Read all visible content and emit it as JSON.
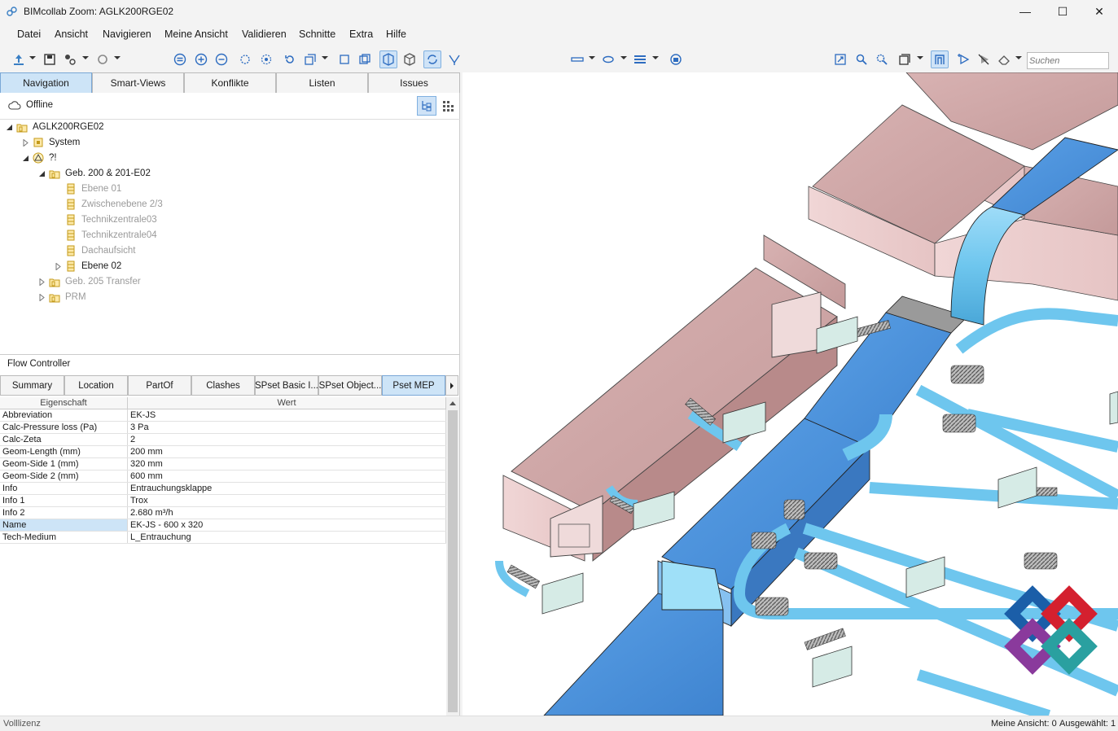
{
  "window": {
    "title": "BIMcollab Zoom: AGLK200RGE02",
    "minimize": "—",
    "maximize": "☐",
    "close": "✕"
  },
  "menu": [
    "Datei",
    "Ansicht",
    "Navigieren",
    "Meine Ansicht",
    "Validieren",
    "Schnitte",
    "Extra",
    "Hilfe"
  ],
  "toolbar": {
    "search_placeholder": "Suchen"
  },
  "nav_tabs": [
    "Navigation",
    "Smart-Views",
    "Konflikte",
    "Listen",
    "Issues"
  ],
  "status_mode": "Offline",
  "tree": [
    {
      "label": "AGLK200RGE02",
      "level": 0,
      "expander": "open",
      "dim": false
    },
    {
      "label": "System",
      "level": 1,
      "expander": "closed",
      "dim": false
    },
    {
      "label": "?!",
      "level": 1,
      "expander": "open",
      "dim": false
    },
    {
      "label": "Geb. 200 & 201-E02",
      "level": 2,
      "expander": "open",
      "dim": false
    },
    {
      "label": "Ebene 01",
      "level": 3,
      "expander": "none",
      "dim": true
    },
    {
      "label": "Zwischenebene 2/3",
      "level": 3,
      "expander": "none",
      "dim": true
    },
    {
      "label": "Technikzentrale03",
      "level": 3,
      "expander": "none",
      "dim": true
    },
    {
      "label": "Technikzentrale04",
      "level": 3,
      "expander": "none",
      "dim": true
    },
    {
      "label": "Dachaufsicht",
      "level": 3,
      "expander": "none",
      "dim": true
    },
    {
      "label": "Ebene 02",
      "level": 3,
      "expander": "closed",
      "dim": false
    },
    {
      "label": "Geb. 205 Transfer",
      "level": 2,
      "expander": "closed",
      "dim": true
    },
    {
      "label": "PRM",
      "level": 2,
      "expander": "closed",
      "dim": true
    }
  ],
  "flow_controller": {
    "title": "Flow Controller",
    "tabs": [
      "Summary",
      "Location",
      "PartOf",
      "Clashes",
      "SPset Basic I...",
      "SPset Object...",
      "Pset MEP"
    ],
    "columns": [
      "Eigenschaft",
      "Wert"
    ],
    "rows": [
      {
        "key": "Abbreviation",
        "value": "EK-JS"
      },
      {
        "key": "Calc-Pressure loss (Pa)",
        "value": "3 Pa"
      },
      {
        "key": "Calc-Zeta",
        "value": "2"
      },
      {
        "key": "Geom-Length (mm)",
        "value": "200 mm"
      },
      {
        "key": "Geom-Side 1 (mm)",
        "value": "320 mm"
      },
      {
        "key": "Geom-Side 2 (mm)",
        "value": "600 mm"
      },
      {
        "key": "Info",
        "value": "Entrauchungsklappe"
      },
      {
        "key": "Info 1",
        "value": "Trox"
      },
      {
        "key": "Info 2",
        "value": "2.680 m³/h"
      },
      {
        "key": "Name",
        "value": "EK-JS - 600 x 320"
      },
      {
        "key": "Tech-Medium",
        "value": "L_Entrauchung"
      }
    ],
    "selected_row": "Name"
  },
  "statusbar": {
    "left": "Volllizenz",
    "view": "Meine Ansicht: 0",
    "selected": "Ausgewählt: 1"
  },
  "colors": {
    "accent": "#cde4f7",
    "duct_pink": "#c79c9c",
    "duct_blue": "#4a90d9",
    "pipe_blue": "#6ec6ee"
  }
}
